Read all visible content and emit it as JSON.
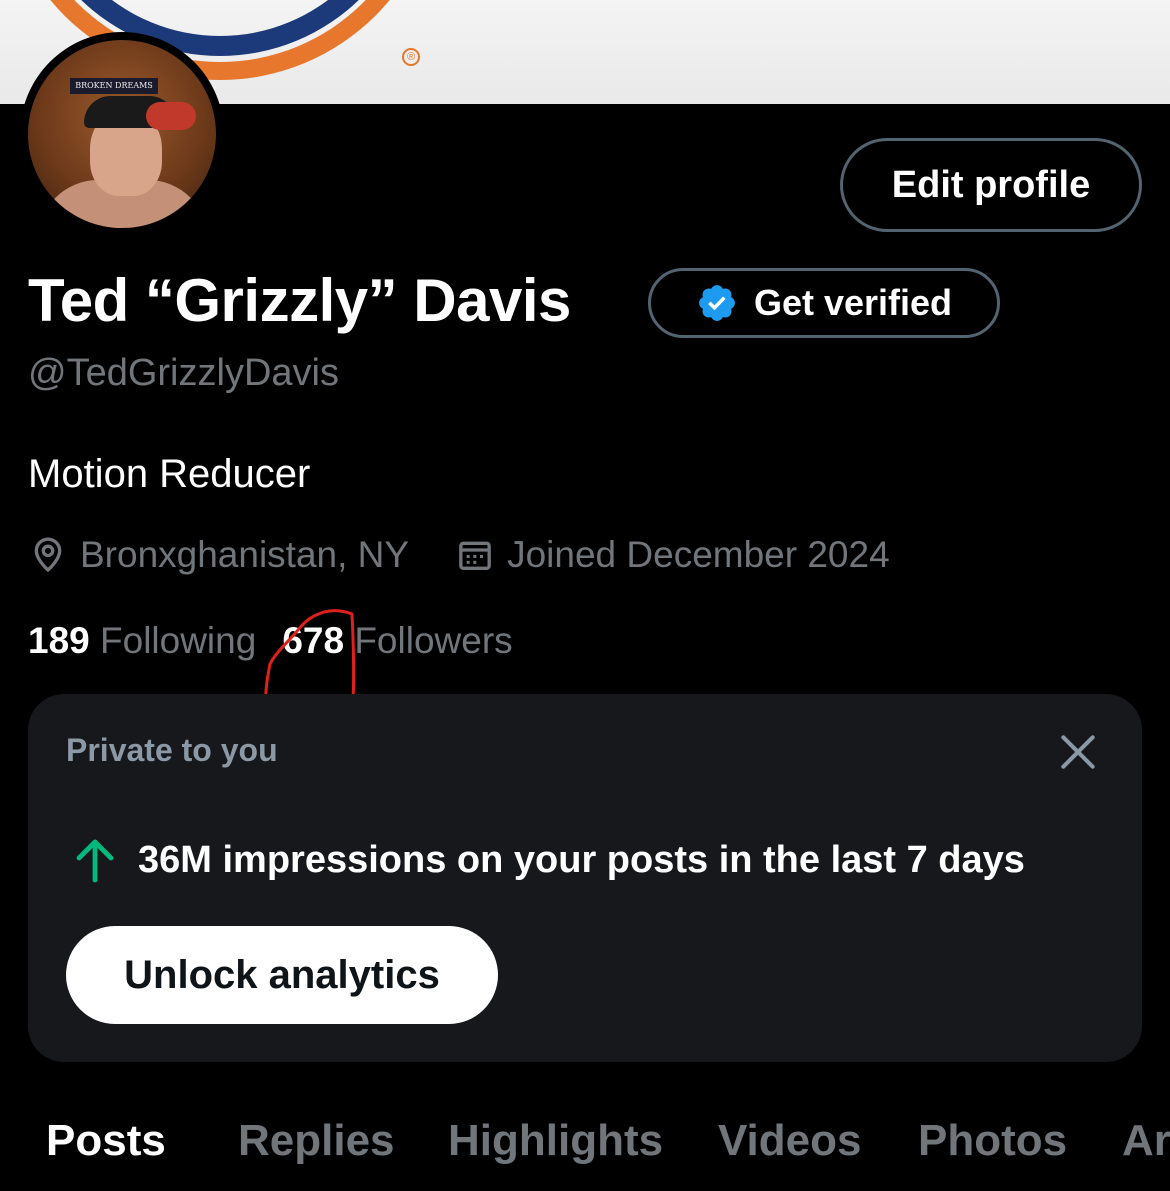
{
  "profile": {
    "name": "Ted “Grizzly” Davis",
    "handle": "@TedGrizzlyDavis",
    "bio": "Motion Reducer",
    "location": "Bronxghanistan, NY",
    "joined": "Joined December 2024",
    "following_count": "189",
    "following_label": "Following",
    "followers_count": "678",
    "followers_label": "Followers",
    "avatar_sign_text": "BROKEN DREAMS"
  },
  "buttons": {
    "edit_profile": "Edit profile",
    "get_verified": "Get verified"
  },
  "analytics_card": {
    "private_label": "Private to you",
    "impressions_text": "36M impressions on your posts in the last 7 days",
    "unlock_label": "Unlock analytics"
  },
  "tabs": [
    {
      "label": "Posts",
      "active": true
    },
    {
      "label": "Replies",
      "active": false
    },
    {
      "label": "Highlights",
      "active": false
    },
    {
      "label": "Videos",
      "active": false
    },
    {
      "label": "Photos",
      "active": false
    },
    {
      "label": "Ar",
      "active": false
    }
  ],
  "colors": {
    "background": "#000000",
    "verified_blue": "#1d9bf0",
    "up_arrow_green": "#00ba7c",
    "annotation_red": "#e0201b",
    "muted_text": "#71767b"
  },
  "icons": {
    "location": "location-pin-icon",
    "calendar": "calendar-icon",
    "verified": "verified-badge-icon",
    "close": "close-icon",
    "trend": "arrow-up-icon"
  }
}
